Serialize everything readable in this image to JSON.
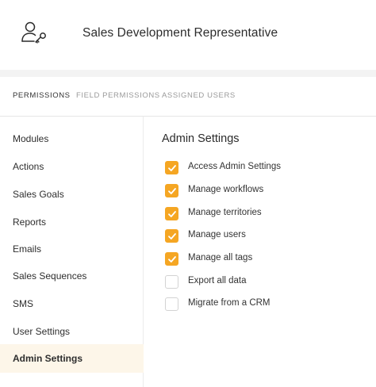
{
  "header": {
    "title": "Sales Development Representative",
    "icon": "user-key-icon"
  },
  "tabs": [
    {
      "label": "Permissions",
      "active": true
    },
    {
      "label": "Field Permissions",
      "active": false
    },
    {
      "label": "Assigned Users",
      "active": false
    }
  ],
  "sidebar": {
    "items": [
      {
        "label": "Modules"
      },
      {
        "label": "Actions"
      },
      {
        "label": "Sales Goals"
      },
      {
        "label": "Reports"
      },
      {
        "label": "Emails"
      },
      {
        "label": "Sales Sequences"
      },
      {
        "label": "SMS"
      },
      {
        "label": "User Settings"
      },
      {
        "label": "Admin Settings",
        "active": true
      }
    ]
  },
  "main": {
    "section_title": "Admin Settings",
    "options": [
      {
        "label": "Access Admin Settings",
        "checked": true
      },
      {
        "label": "Manage workflows",
        "checked": true
      },
      {
        "label": "Manage territories",
        "checked": true
      },
      {
        "label": "Manage users",
        "checked": true
      },
      {
        "label": "Manage all tags",
        "checked": true
      },
      {
        "label": "Export all data",
        "checked": false
      },
      {
        "label": "Migrate from a CRM",
        "checked": false
      }
    ]
  },
  "colors": {
    "accent": "#f5a623",
    "active_row_bg": "#fdf6e9"
  }
}
